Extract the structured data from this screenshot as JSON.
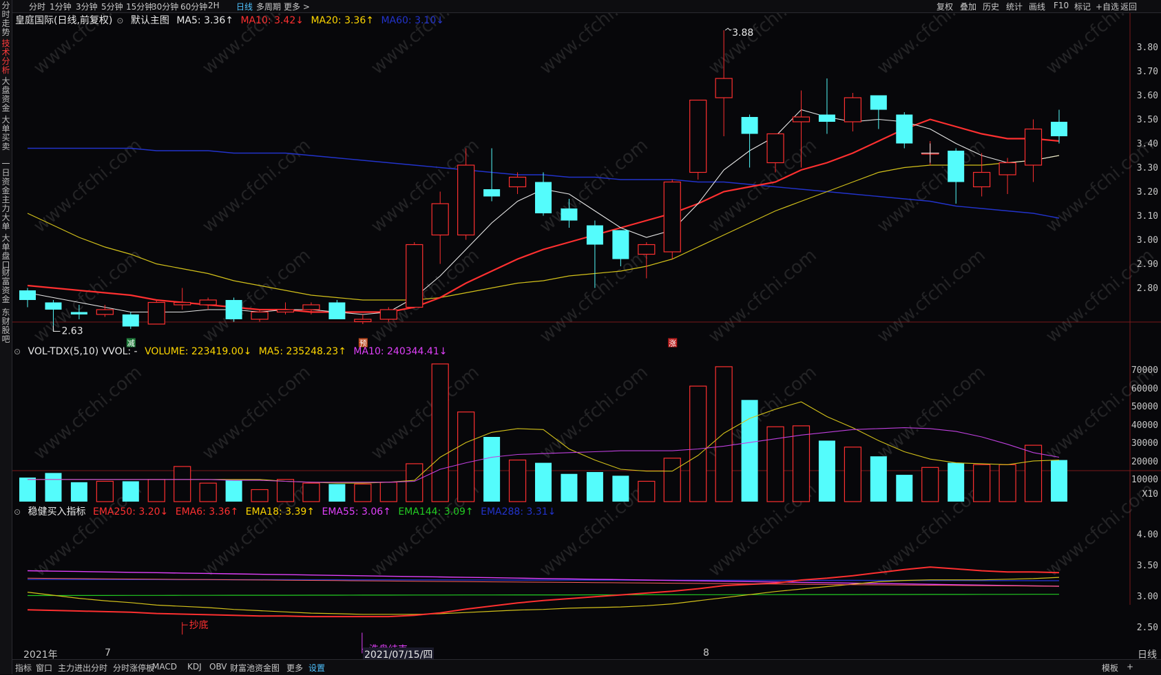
{
  "left_tabs": [
    {
      "label": "分时走势",
      "active": false
    },
    {
      "label": "技术分析",
      "active": true
    },
    {
      "label": "大盘资金",
      "active": false
    },
    {
      "label": "大单买卖",
      "active": false
    },
    {
      "label": "一日资金",
      "active": false
    },
    {
      "label": "主力大单",
      "active": false
    },
    {
      "label": "大单盘口",
      "active": false
    },
    {
      "label": "财富资金",
      "active": false
    },
    {
      "label": "东财股吧",
      "active": false
    }
  ],
  "period_tabs": [
    {
      "label": "分时",
      "active": false
    },
    {
      "label": "1分钟",
      "active": false
    },
    {
      "label": "3分钟",
      "active": false
    },
    {
      "label": "5分钟",
      "active": false
    },
    {
      "label": "15分钟",
      "active": false
    },
    {
      "label": "30分钟",
      "active": false
    },
    {
      "label": "60分钟",
      "active": false
    },
    {
      "label": "2H",
      "active": false
    },
    {
      "label": "日线",
      "active": true
    },
    {
      "label": "多周期",
      "active": false
    },
    {
      "label": "更多 >",
      "active": false
    }
  ],
  "right_tools": [
    "复权",
    "叠加",
    "历史",
    "统计",
    "画线",
    "F10",
    "标记",
    "+自选",
    "返回"
  ],
  "main_legend": {
    "title": "皇庭国际(日线,前复权)",
    "template": "默认主图",
    "items": [
      {
        "text": "MA5: 3.36↑",
        "color": "#e8e8e8"
      },
      {
        "text": "MA10: 3.42↓",
        "color": "#ff3030"
      },
      {
        "text": "MA20: 3.36↑",
        "color": "#ffd700"
      },
      {
        "text": "MA60: 3.10↓",
        "color": "#2233cc"
      }
    ]
  },
  "price_axis": [
    "3.80",
    "3.70",
    "3.60",
    "3.50",
    "3.40",
    "3.30",
    "3.20",
    "3.10",
    "3.00",
    "2.90",
    "2.80"
  ],
  "vol_legend": {
    "title": "VOL-TDX(5,10) VVOL: -",
    "items": [
      {
        "text": "VOLUME: 223419.00↓",
        "color": "#ffd700"
      },
      {
        "text": "MA5: 235248.23↑",
        "color": "#ffd700"
      },
      {
        "text": "MA10: 240344.41↓",
        "color": "#e040fb"
      }
    ]
  },
  "vol_axis": [
    "70000",
    "60000",
    "50000",
    "40000",
    "30000",
    "20000",
    "10000"
  ],
  "vol_unit": "X10",
  "ind_legend": {
    "title": "稳健买入指标",
    "items": [
      {
        "text": "EMA250: 3.20↓",
        "color": "#ff3030"
      },
      {
        "text": "EMA6: 3.36↑",
        "color": "#ff3030"
      },
      {
        "text": "EMA18: 3.39↑",
        "color": "#ffd700"
      },
      {
        "text": "EMA55: 3.06↑",
        "color": "#e040fb"
      },
      {
        "text": "EMA144: 3.09↑",
        "color": "#22cc22"
      },
      {
        "text": "EMA288: 3.31↓",
        "color": "#2233cc"
      }
    ]
  },
  "ind_axis": [
    "4.00",
    "3.50",
    "3.00",
    "2.50"
  ],
  "annotations": {
    "high": "3.88",
    "low": "2.63",
    "bottom_signal": "抄底",
    "wash_end": "洗盘结束",
    "marker1": "减",
    "marker2": "预",
    "marker3": "涨"
  },
  "date_axis": {
    "year": "2021年",
    "m7": "7",
    "selected": "2021/07/15/四",
    "m8": "8",
    "period": "日线"
  },
  "bottom_tabs": [
    {
      "label": "指标",
      "active": false
    },
    {
      "label": "窗口",
      "active": false
    },
    {
      "label": "主力进出分时",
      "active": false
    },
    {
      "label": "分时涨停板",
      "active": false
    },
    {
      "label": "MACD",
      "active": false
    },
    {
      "label": "KDJ",
      "active": false
    },
    {
      "label": "OBV",
      "active": false
    },
    {
      "label": "财富池资金图",
      "active": false
    },
    {
      "label": "更多",
      "active": false
    },
    {
      "label": "设置",
      "active": true
    }
  ],
  "bottom_right": {
    "template": "模板",
    "plus": "+"
  },
  "watermark": "www.cfchi.com",
  "chart_data": {
    "type": "candlestick",
    "candles": [
      {
        "o": 2.8,
        "c": 2.76,
        "h": 2.81,
        "l": 2.73
      },
      {
        "o": 2.75,
        "c": 2.72,
        "h": 2.76,
        "l": 2.63
      },
      {
        "o": 2.71,
        "c": 2.7,
        "h": 2.74,
        "l": 2.68
      },
      {
        "o": 2.7,
        "c": 2.72,
        "h": 2.74,
        "l": 2.69
      },
      {
        "o": 2.7,
        "c": 2.65,
        "h": 2.71,
        "l": 2.64
      },
      {
        "o": 2.66,
        "c": 2.75,
        "h": 2.76,
        "l": 2.66
      },
      {
        "o": 2.74,
        "c": 2.75,
        "h": 2.81,
        "l": 2.72
      },
      {
        "o": 2.74,
        "c": 2.76,
        "h": 2.77,
        "l": 2.72
      },
      {
        "o": 2.76,
        "c": 2.68,
        "h": 2.77,
        "l": 2.67
      },
      {
        "o": 2.68,
        "c": 2.71,
        "h": 2.72,
        "l": 2.67
      },
      {
        "o": 2.71,
        "c": 2.72,
        "h": 2.75,
        "l": 2.7
      },
      {
        "o": 2.72,
        "c": 2.74,
        "h": 2.75,
        "l": 2.7
      },
      {
        "o": 2.75,
        "c": 2.68,
        "h": 2.76,
        "l": 2.68
      },
      {
        "o": 2.67,
        "c": 2.68,
        "h": 2.7,
        "l": 2.66
      },
      {
        "o": 2.68,
        "c": 2.72,
        "h": 2.73,
        "l": 2.67
      },
      {
        "o": 2.73,
        "c": 2.99,
        "h": 3.0,
        "l": 2.73
      },
      {
        "o": 3.03,
        "c": 3.16,
        "h": 3.21,
        "l": 2.91
      },
      {
        "o": 3.03,
        "c": 3.32,
        "h": 3.39,
        "l": 3.01
      },
      {
        "o": 3.22,
        "c": 3.19,
        "h": 3.39,
        "l": 3.17
      },
      {
        "o": 3.23,
        "c": 3.27,
        "h": 3.29,
        "l": 3.2
      },
      {
        "o": 3.25,
        "c": 3.12,
        "h": 3.29,
        "l": 3.11
      },
      {
        "o": 3.14,
        "c": 3.09,
        "h": 3.18,
        "l": 3.06
      },
      {
        "o": 3.07,
        "c": 2.99,
        "h": 3.09,
        "l": 2.81
      },
      {
        "o": 3.05,
        "c": 2.93,
        "h": 3.05,
        "l": 2.9
      },
      {
        "o": 2.95,
        "c": 2.99,
        "h": 3.0,
        "l": 2.85
      },
      {
        "o": 2.96,
        "c": 3.25,
        "h": 3.26,
        "l": 2.93
      },
      {
        "o": 3.29,
        "c": 3.59,
        "h": 3.59,
        "l": 3.26
      },
      {
        "o": 3.6,
        "c": 3.68,
        "h": 3.88,
        "l": 3.44
      },
      {
        "o": 3.52,
        "c": 3.45,
        "h": 3.53,
        "l": 3.31
      },
      {
        "o": 3.33,
        "c": 3.45,
        "h": 3.45,
        "l": 3.29
      },
      {
        "o": 3.5,
        "c": 3.52,
        "h": 3.63,
        "l": 3.31
      },
      {
        "o": 3.53,
        "c": 3.5,
        "h": 3.68,
        "l": 3.45
      },
      {
        "o": 3.5,
        "c": 3.6,
        "h": 3.62,
        "l": 3.46
      },
      {
        "o": 3.61,
        "c": 3.55,
        "h": 3.61,
        "l": 3.47
      },
      {
        "o": 3.53,
        "c": 3.41,
        "h": 3.54,
        "l": 3.39
      },
      {
        "o": 3.37,
        "c": 3.37,
        "h": 3.42,
        "l": 3.32
      },
      {
        "o": 3.38,
        "c": 3.25,
        "h": 3.39,
        "l": 3.16
      },
      {
        "o": 3.23,
        "c": 3.29,
        "h": 3.37,
        "l": 3.19
      },
      {
        "o": 3.28,
        "c": 3.33,
        "h": 3.35,
        "l": 3.2
      },
      {
        "o": 3.32,
        "c": 3.47,
        "h": 3.51,
        "l": 3.25
      },
      {
        "o": 3.5,
        "c": 3.44,
        "h": 3.55,
        "l": 3.41
      }
    ],
    "ma5": [
      2.79,
      2.77,
      2.75,
      2.73,
      2.71,
      2.71,
      2.71,
      2.72,
      2.72,
      2.71,
      2.72,
      2.72,
      2.71,
      2.7,
      2.71,
      2.77,
      2.86,
      2.97,
      3.08,
      3.17,
      3.22,
      3.2,
      3.13,
      3.06,
      3.02,
      3.05,
      3.16,
      3.3,
      3.38,
      3.44,
      3.55,
      3.52,
      3.5,
      3.51,
      3.5,
      3.47,
      3.41,
      3.36,
      3.33,
      3.34,
      3.36
    ],
    "ma10": [
      2.82,
      2.81,
      2.8,
      2.79,
      2.78,
      2.76,
      2.75,
      2.74,
      2.73,
      2.72,
      2.72,
      2.71,
      2.71,
      2.71,
      2.71,
      2.73,
      2.77,
      2.83,
      2.88,
      2.93,
      2.97,
      3.0,
      3.03,
      3.06,
      3.09,
      3.12,
      3.16,
      3.21,
      3.23,
      3.25,
      3.3,
      3.33,
      3.37,
      3.42,
      3.47,
      3.51,
      3.48,
      3.45,
      3.43,
      3.43,
      3.42
    ],
    "ma20": [
      3.12,
      3.07,
      3.02,
      2.98,
      2.95,
      2.91,
      2.89,
      2.87,
      2.84,
      2.82,
      2.8,
      2.78,
      2.77,
      2.76,
      2.76,
      2.76,
      2.77,
      2.79,
      2.81,
      2.83,
      2.84,
      2.86,
      2.87,
      2.88,
      2.9,
      2.93,
      2.98,
      3.03,
      3.08,
      3.13,
      3.17,
      3.21,
      3.25,
      3.29,
      3.31,
      3.32,
      3.32,
      3.32,
      3.33,
      3.34,
      3.36
    ],
    "ma60": [
      3.39,
      3.39,
      3.39,
      3.39,
      3.39,
      3.38,
      3.38,
      3.38,
      3.37,
      3.37,
      3.37,
      3.36,
      3.35,
      3.34,
      3.33,
      3.32,
      3.31,
      3.3,
      3.29,
      3.28,
      3.28,
      3.27,
      3.27,
      3.26,
      3.26,
      3.26,
      3.25,
      3.25,
      3.24,
      3.23,
      3.22,
      3.21,
      3.2,
      3.19,
      3.18,
      3.17,
      3.15,
      3.14,
      3.13,
      3.12,
      3.1
    ],
    "volumes": [
      13000,
      15500,
      10500,
      11000,
      11000,
      12000,
      19000,
      10000,
      11500,
      6500,
      12000,
      10000,
      9500,
      9500,
      10500,
      20500,
      74500,
      48500,
      35000,
      22500,
      21000,
      15000,
      16000,
      14000,
      11000,
      23500,
      62500,
      73000,
      55000,
      40500,
      41000,
      33000,
      29500,
      24500,
      14500,
      18500,
      21000,
      20000,
      20000,
      30500,
      22500
    ],
    "vol_ma5": [
      12000,
      12000,
      12000,
      12000,
      12000,
      12000,
      12000,
      12000,
      12000,
      12000,
      11000,
      10500,
      10000,
      10000,
      10500,
      11500,
      24000,
      32000,
      37500,
      39500,
      39000,
      28500,
      22500,
      17500,
      16500,
      16500,
      25000,
      37000,
      45000,
      50000,
      54000,
      46000,
      40000,
      33000,
      27000,
      23000,
      21000,
      20500,
      20000,
      22000,
      22500
    ],
    "vol_ma10": [
      12000,
      12000,
      12000,
      12000,
      12000,
      12000,
      12000,
      12000,
      11500,
      11500,
      11000,
      10500,
      10500,
      10500,
      10500,
      11000,
      17500,
      21000,
      24000,
      25500,
      26000,
      26500,
      27000,
      27500,
      27500,
      27500,
      28500,
      30000,
      32000,
      34000,
      36000,
      37500,
      39000,
      39500,
      40000,
      39500,
      38000,
      35000,
      31000,
      26500,
      24000
    ]
  }
}
